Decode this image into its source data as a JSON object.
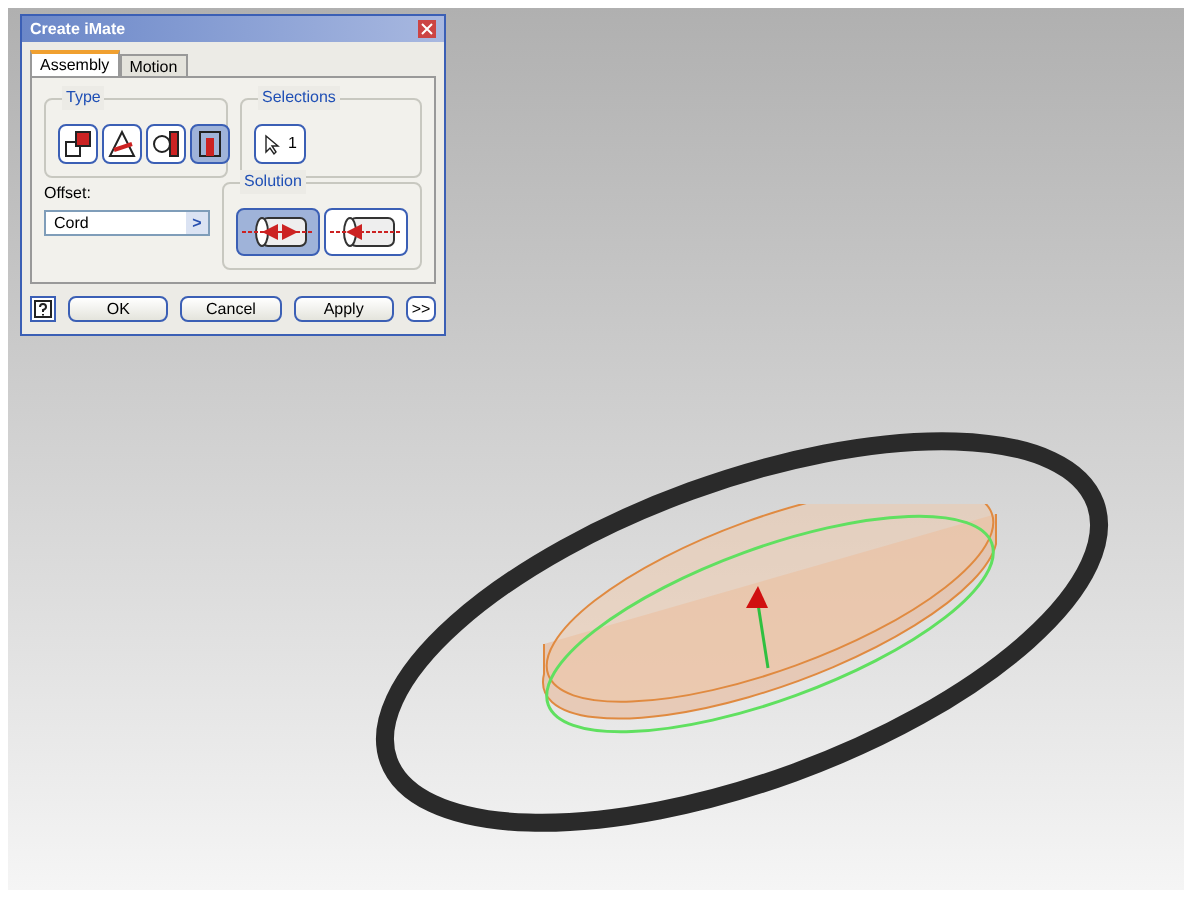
{
  "dialog": {
    "title": "Create iMate",
    "tabs": [
      {
        "label": "Assembly",
        "selected": true
      },
      {
        "label": "Motion",
        "selected": false
      }
    ],
    "type_group": {
      "label": "Type",
      "options": [
        {
          "kind": "mate",
          "selected": false
        },
        {
          "kind": "angle",
          "selected": false
        },
        {
          "kind": "tangent",
          "selected": false
        },
        {
          "kind": "insert",
          "selected": true
        }
      ]
    },
    "selections_group": {
      "label": "Selections",
      "count": "1"
    },
    "offset": {
      "label": "Offset:",
      "value": "Cord",
      "arrow": ">"
    },
    "solution_group": {
      "label": "Solution",
      "options": [
        {
          "kind": "opposed",
          "selected": true
        },
        {
          "kind": "aligned",
          "selected": false
        }
      ]
    },
    "buttons": [
      "OK",
      "Cancel",
      "Apply"
    ],
    "more": ">>"
  }
}
